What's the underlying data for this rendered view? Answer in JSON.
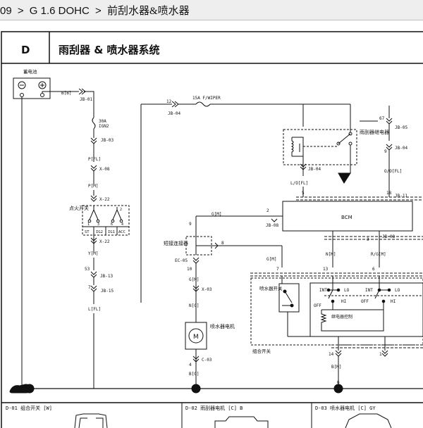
{
  "breadcrumb": {
    "model": "09",
    "engine": "G 1.6 DOHC",
    "current": "前刮水器&喷水器",
    "separator": ">"
  },
  "diagram": {
    "section_code": "D",
    "title": "雨刮器 & 喷水器系统",
    "battery_label": "蓄电池",
    "wire_battery": "B[B]",
    "jb01": "JB-01",
    "fuse30": "30A",
    "fuse30_name": "IGN2",
    "jb03": "JB-03",
    "wire_pfl": "P[FL]",
    "x08": "X-08",
    "wire_pm": "P[M]",
    "x22": "X-22",
    "ign_switch": "点火开关",
    "ign_positions": [
      "ST",
      "IG2",
      "IG1",
      "ACC"
    ],
    "pin_nums": [
      "1",
      "3",
      "6",
      "4",
      "2"
    ],
    "x22b": "X-22",
    "wire_ym": "Y[M]",
    "pin53": "53",
    "jb13": "JB-13",
    "pin7": "7",
    "jb15": "JB-15",
    "wire_lfl": "L[FL]",
    "pin12": "12",
    "jb04": "JB-04",
    "fuse15": "15A F/WIPER",
    "relay_label": "雨刮器继电器",
    "jb04b": "JB-04",
    "wire_lofl": "L/O[FL]",
    "pin67": "67",
    "jb05": "JB-05",
    "pin9": "9",
    "jb04c": "JB-04",
    "wire_ofl": "O/O[FL]",
    "pin5": "5",
    "pin18": "18",
    "jb11": "JB-11",
    "bcm": "BCM",
    "pin2": "2",
    "jb08": "JB-08",
    "pin3": "3",
    "jb08b": "JB-08",
    "wire_gm": "G[M]",
    "pin9b": "9",
    "short_conn": "短接连接器",
    "pin8": "8",
    "ec05": "EC-05",
    "pin10": "10",
    "wire_gm2": "G[M]",
    "x03": "X-03",
    "wire_gm3": "G[M]",
    "wire_nm": "N[M]",
    "wire_rgm": "R/G[M]",
    "pin7b": "7",
    "pin13": "13",
    "pin6": "6",
    "washer_switch": "喷水器开关",
    "int_label": "INT",
    "lo_label": "LO",
    "hi_label": "HI",
    "off_label": "OFF",
    "int_label2": "INT",
    "lo_label2": "LO",
    "hi_label2": "HI",
    "off_label2": "OFF",
    "intermittent": "继电器控制",
    "combo_switch": "组合开关",
    "pin14": "14",
    "wire_nc": "N[C]",
    "motor_label": "喷水器电机",
    "motor_m": "M",
    "c03": "C-03",
    "wire_bc": "B[C]",
    "pin4": "4",
    "wire_bm": "B[M]",
    "pin6b": "6",
    "ground_g": "G",
    "ground_13": "13",
    "ground_1": "1",
    "conn_d01": "D-01 组合开关 [W]",
    "conn_d02": "D-02 雨刮器电机 [C] B",
    "conn_d03": "D-03 喷水器电机 [C] GY"
  },
  "colors": {
    "line": "#111111",
    "topbar": "#eeeeee"
  }
}
